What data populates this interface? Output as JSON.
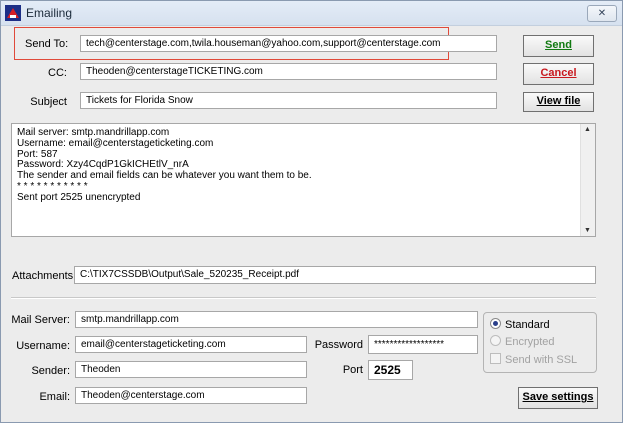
{
  "window": {
    "title": "Emailing",
    "close_glyph": "✕"
  },
  "colors": {
    "highlight": "#e04a3a",
    "cancel_text": "#c8181e",
    "send_text": "#127a12"
  },
  "message": {
    "send_to_label": "Send To:",
    "send_to_value": "tech@centerstage.com,twila.houseman@yahoo.com,support@centerstage.com",
    "cc_label": "CC:",
    "cc_value": "Theoden@centerstageTICKETING.com",
    "subject_label": "Subject",
    "subject_value": "Tickets for Florida Snow",
    "body": "Mail server: smtp.mandrillapp.com\nUsername: email@centerstageticketing.com\nPort: 587\nPassword: Xzy4CqdP1GkICHEtlV_nrA\nThe sender and email fields can be whatever you want them to be.\n* * * * * * * * * * *\nSent port 2525 unencrypted",
    "attachments_label": "Attachments",
    "attachments_value": "C:\\TIX7CSSDB\\Output\\Sale_520235_Receipt.pdf"
  },
  "buttons": {
    "send": "Send",
    "cancel": "Cancel",
    "view_file": "View file",
    "save_settings": "Save settings"
  },
  "settings": {
    "mail_server_label": "Mail Server:",
    "mail_server_value": "smtp.mandrillapp.com",
    "username_label": "Username:",
    "username_value": "email@centerstageticketing.com",
    "sender_label": "Sender:",
    "sender_value": "Theoden",
    "email_label": "Email:",
    "email_value": "Theoden@centerstage.com",
    "password_label": "Password",
    "password_value": "******************",
    "port_label": "Port",
    "port_value": "2525"
  },
  "security": {
    "standard_label": "Standard",
    "standard_selected": true,
    "encrypted_label": "Encrypted",
    "ssl_label": "Send with SSL"
  }
}
